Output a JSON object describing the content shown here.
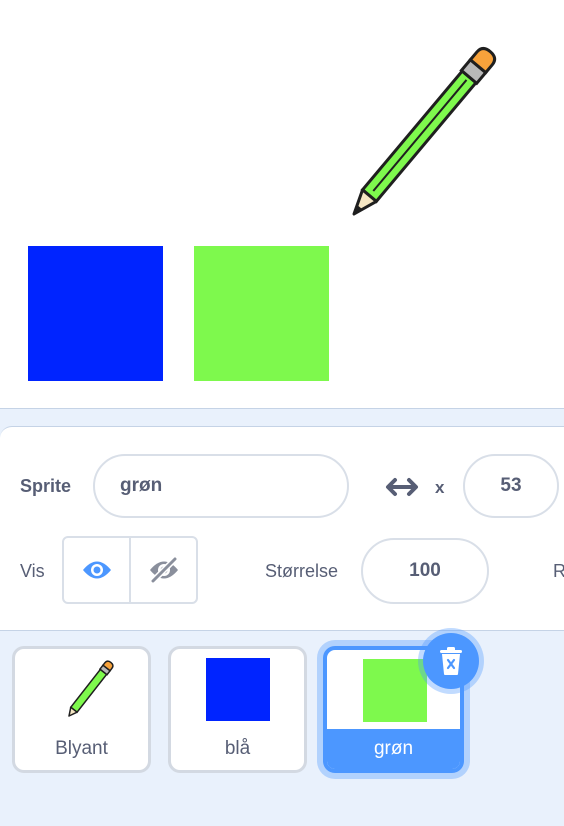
{
  "stage": {
    "colors": {
      "blue": "#0024ff",
      "green": "#7ef94d"
    },
    "icon": "pencil-icon"
  },
  "sprite_info": {
    "sprite_label": "Sprite",
    "sprite_name": "grøn",
    "x_label": "x",
    "x_value": "53",
    "show_label": "Vis",
    "size_label": "Størrelse",
    "size_value": "100",
    "cutoff_label": "R"
  },
  "sprites": [
    {
      "name": "Blyant",
      "thumb": "pencil-icon",
      "selected": false
    },
    {
      "name": "blå",
      "thumb": "#0024ff",
      "selected": false
    },
    {
      "name": "grøn",
      "thumb": "#7ef94d",
      "selected": true
    }
  ],
  "accent_color": "#4c97ff"
}
